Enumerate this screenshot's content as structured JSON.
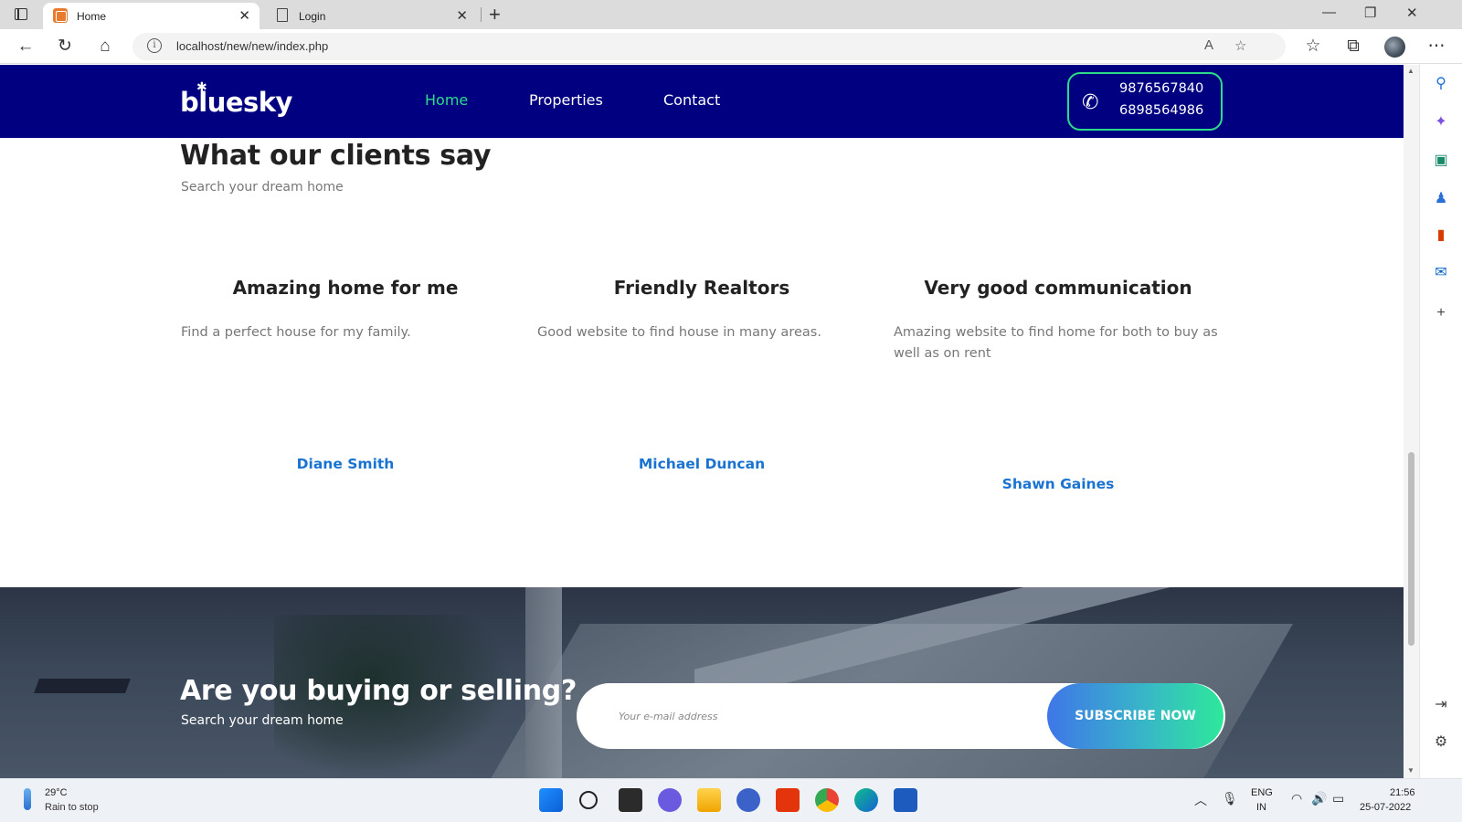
{
  "browser": {
    "tabs": [
      {
        "title": "Home",
        "close": "✕"
      },
      {
        "title": "Login",
        "close": "✕"
      }
    ],
    "new_tab": "+",
    "window_controls": {
      "minimize": "—",
      "maximize": "❐",
      "close": "✕"
    },
    "url": "localhost/new/new/index.php",
    "icons": [
      "back-icon",
      "refresh-icon",
      "home-icon",
      "info-icon",
      "read-aloud-icon",
      "add-favorite-icon",
      "favorites-icon",
      "collections-icon",
      "profile-icon",
      "more-icon"
    ]
  },
  "nav": {
    "logo": "bluesky",
    "links": [
      {
        "label": "Home",
        "active": true
      },
      {
        "label": "Properties",
        "active": false
      },
      {
        "label": "Contact",
        "active": false
      }
    ],
    "phones": [
      "9876567840",
      "6898564986"
    ],
    "accent_color": "#2ddc8a",
    "bar_color": "#000080"
  },
  "testimonials_section": {
    "title": "What our clients say",
    "subtitle": "Search your dream home",
    "items": [
      {
        "title": "Amazing home for me",
        "text": "Find a perfect house for my family.",
        "author": "Diane Smith"
      },
      {
        "title": "Friendly Realtors",
        "text": "Good website to find house in many areas.",
        "author": "Michael Duncan"
      },
      {
        "title": "Very good communication",
        "text": "Amazing website to find home for both to buy as well as on rent",
        "author": "Shawn Gaines"
      }
    ]
  },
  "cta": {
    "title": "Are you buying or selling?",
    "subtitle": "Search your dream home",
    "email_placeholder": "Your e-mail address",
    "button": "SUBSCRIBE NOW"
  },
  "taskbar": {
    "weather": {
      "temp": "29°C",
      "desc": "Rain to stop"
    },
    "language": {
      "lang": "ENG",
      "region": "IN"
    },
    "time": "21:56",
    "date": "25-07-2022"
  }
}
